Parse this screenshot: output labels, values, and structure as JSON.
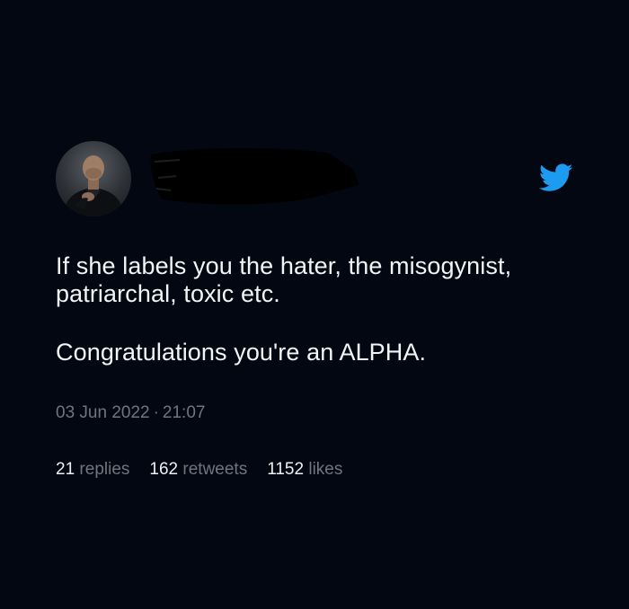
{
  "tweet": {
    "line1": "If she labels you the hater, the misogynist,",
    "line2": "patriarchal, toxic etc.",
    "line3": "Congratulations you're an ALPHA."
  },
  "meta": {
    "date": "03 Jun 2022",
    "separator": "·",
    "time": "21:07"
  },
  "stats": {
    "replies_count": "21",
    "replies_label": "replies",
    "retweets_count": "162",
    "retweets_label": "retweets",
    "likes_count": "1152",
    "likes_label": "likes"
  },
  "icons": {
    "avatar": "profile-photo",
    "bird": "twitter-bird-icon",
    "redaction": "redacted-name-scribble"
  },
  "colors": {
    "background": "#030712",
    "text": "#f2f4f6",
    "muted": "#6e767d",
    "brand": "#1d9bf0"
  }
}
